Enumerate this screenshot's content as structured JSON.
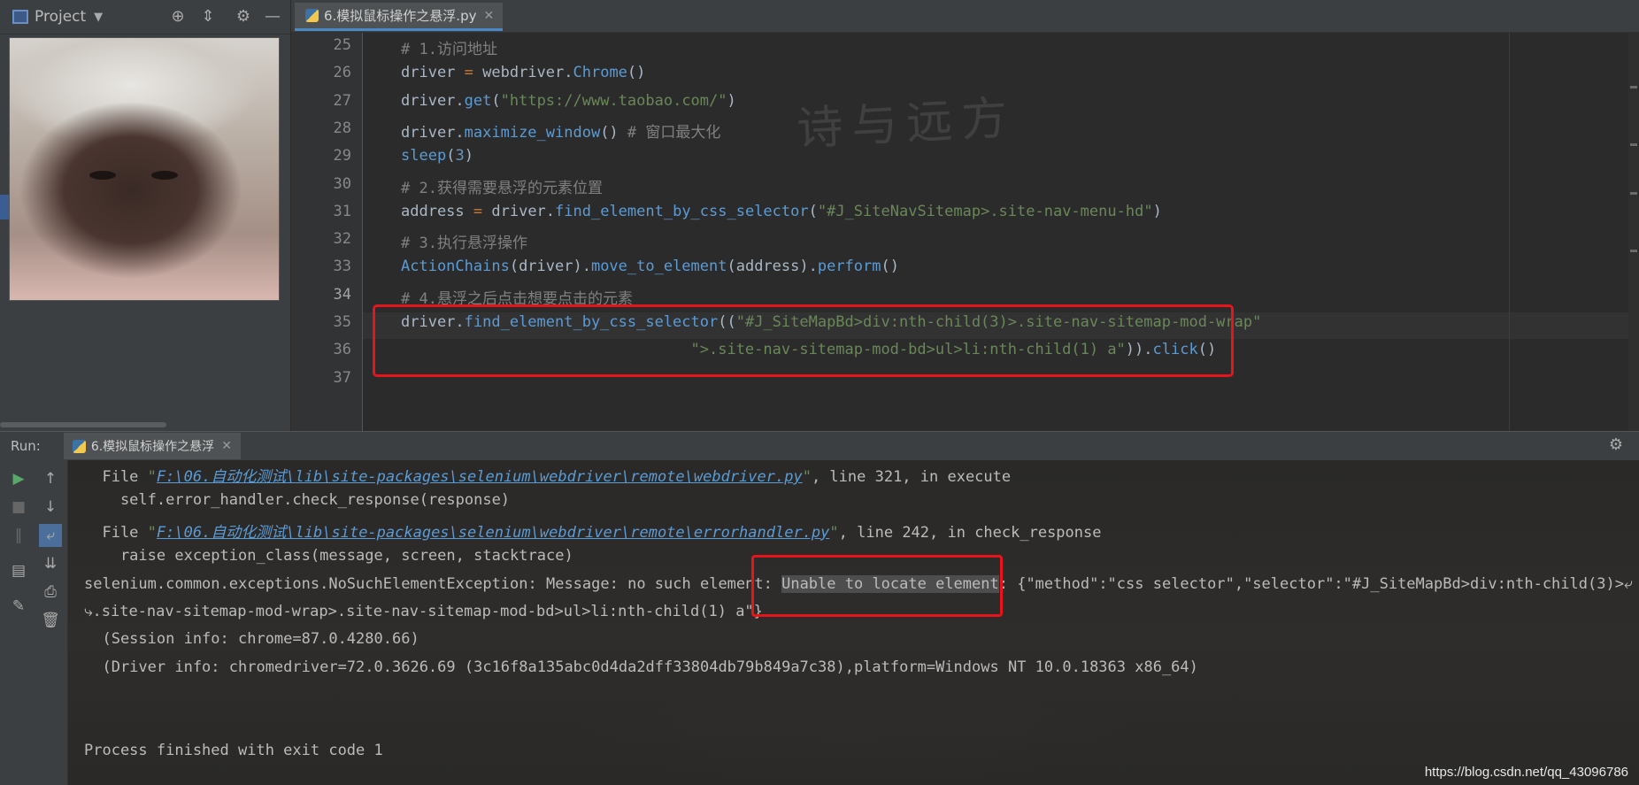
{
  "project_panel": {
    "title": "Project",
    "header_icons": [
      "crosshair-icon",
      "collapse-icon",
      "gear-icon",
      "minimize-icon"
    ]
  },
  "editor": {
    "tab_label": "6.模拟鼠标操作之悬浮.py",
    "watermark_text": "诗与远方",
    "lines": [
      {
        "num": "25",
        "html": "<span class=\"cmt\"># 1.访问地址</span>"
      },
      {
        "num": "26",
        "html": "driver <span class=\"op\">=</span> webdriver.<span class=\"fn\">Chrome</span>()"
      },
      {
        "num": "27",
        "html": "driver.<span class=\"fn\">get</span>(<span class=\"str\">\"https://www.taobao.com/\"</span>)"
      },
      {
        "num": "28",
        "html": "driver.<span class=\"fn\">maximize_window</span>() <span class=\"cmt\"># 窗口最大化</span>"
      },
      {
        "num": "29",
        "html": "<span class=\"fn\">sleep</span>(<span class=\"num\">3</span>)"
      },
      {
        "num": "30",
        "html": "<span class=\"cmt\"># 2.获得需要悬浮的元素位置</span>"
      },
      {
        "num": "31",
        "html": "address <span class=\"op\">=</span> driver.<span class=\"fn\">find_element_by_css_selector</span>(<span class=\"str\">\"#J_SiteNavSitemap>.site-nav-menu-hd\"</span>)"
      },
      {
        "num": "32",
        "html": "<span class=\"cmt\"># 3.执行悬浮操作</span>"
      },
      {
        "num": "33",
        "html": "<span class=\"fn\">ActionChains</span>(driver).<span class=\"fn\">move_to_element</span>(address).<span class=\"fn\">perform</span>()"
      },
      {
        "num": "34",
        "html": "<span class=\"cmt\"># 4.悬浮之后点击想要点击的元素</span>"
      },
      {
        "num": "35",
        "html": "driver.<span class=\"fn\">find_element_by_css_selector</span>((<span class=\"str\">\"#J_SiteMapBd>div:nth-child(3)>.site-nav-sitemap-mod-wrap\"</span>"
      },
      {
        "num": "36",
        "html": "                                <span class=\"str\">\">.site-nav-sitemap-mod-bd>ul>li:nth-child(1) a\"</span>)).<span class=\"fn\">click</span>()"
      },
      {
        "num": "37",
        "html": ""
      }
    ]
  },
  "run": {
    "label": "Run:",
    "tab_label": "6.模拟鼠标操作之悬浮",
    "console": [
      {
        "html": "  File <span class=\"str\">\"</span><span class=\"link\">F:\\06.自动化测试\\lib\\site-packages\\selenium\\webdriver\\remote\\webdriver.py</span><span class=\"str\">\"</span>, line 321, in execute"
      },
      {
        "html": "    self.error_handler.check_response(response)"
      },
      {
        "html": "  File <span class=\"str\">\"</span><span class=\"link\">F:\\06.自动化测试\\lib\\site-packages\\selenium\\webdriver\\remote\\errorhandler.py</span><span class=\"str\">\"</span>, line 242, in check_response"
      },
      {
        "html": "    raise exception_class(message, screen, stacktrace)"
      },
      {
        "html": "selenium.common.exceptions.NoSuchElementException: Message: no such element: <span class=\"hl\">Unable to locate element</span>: {\"method\":\"css selector\",\"selector\":\"#J_SiteMapBd>div:nth-child(3)>⤶"
      },
      {
        "html": "⤷.site-nav-sitemap-mod-wrap>.site-nav-sitemap-mod-bd>ul>li:nth-child(1) a\"}"
      },
      {
        "html": "  (Session info: chrome=87.0.4280.66)"
      },
      {
        "html": "  (Driver info: chromedriver=72.0.3626.69 (3c16f8a135abc0d4da2dff33804db79b849a7c38),platform=Windows NT 10.0.18363 x86_64)"
      },
      {
        "html": ""
      },
      {
        "html": ""
      },
      {
        "html": "Process finished with exit code 1"
      }
    ]
  },
  "watermark_url": "https://blog.csdn.net/qq_43096786"
}
